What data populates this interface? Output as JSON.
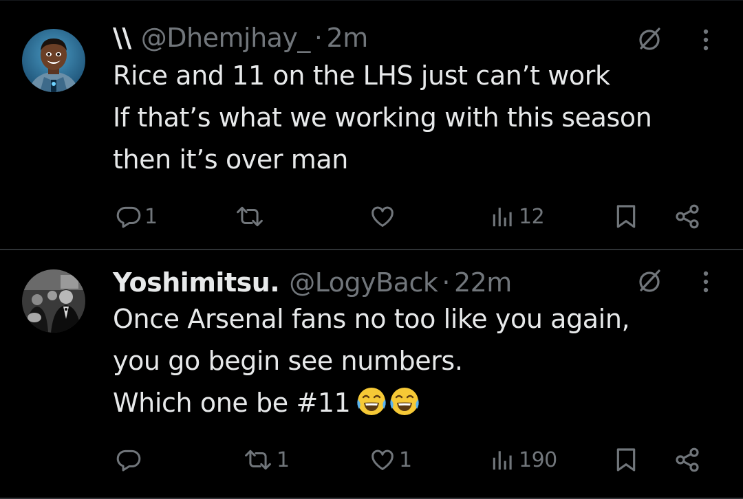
{
  "tweets": [
    {
      "display_name": "\\\\",
      "handle": "@Dhemjhay_",
      "separator": "·",
      "time": "2m",
      "text_lines": [
        "Rice and 11 on the LHS just can’t work",
        "If that’s what we working with this season",
        "then it’s over man"
      ],
      "replies": "1",
      "reposts": "",
      "likes": "",
      "views": "12"
    },
    {
      "display_name": "Yoshimitsu.",
      "handle": "@LogyBack",
      "separator": "·",
      "time": "22m",
      "text_lines": [
        "Once Arsenal fans no too like you again,",
        "you go begin see numbers.",
        "Which one be #11"
      ],
      "emojis": [
        "face-with-tears-of-joy",
        "face-with-tears-of-joy"
      ],
      "replies": "",
      "reposts": "1",
      "likes": "1",
      "views": "190"
    }
  ],
  "icons": {
    "reply": "reply-icon",
    "repost": "repost-icon",
    "like": "like-icon",
    "views": "views-icon",
    "bookmark": "bookmark-icon",
    "share": "share-icon",
    "grok": "grok-icon",
    "more": "more-icon"
  },
  "colors": {
    "background": "#000000",
    "text": "#e7e9ea",
    "secondary": "#71767b",
    "divider": "#2f3336"
  }
}
